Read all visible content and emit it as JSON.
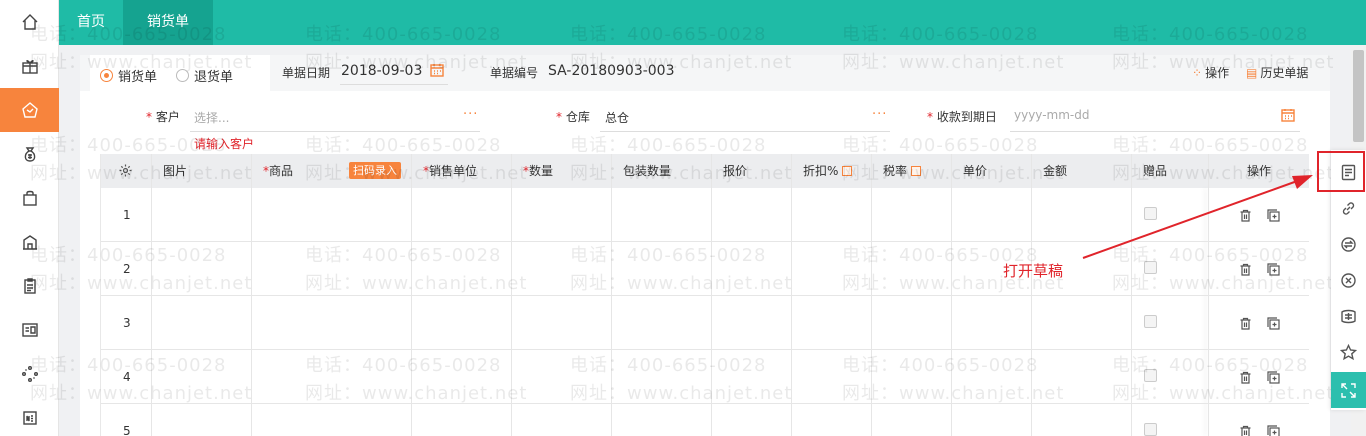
{
  "topbar": {
    "tab_home": "首页",
    "tab_active": "销货单"
  },
  "doc_type": {
    "sales": "销货单",
    "return": "退货单",
    "selected": "销货单"
  },
  "header": {
    "date_label": "单据日期",
    "date_value": "2018-09-03",
    "docno_label": "单据编号",
    "docno_value": "SA-20180903-003",
    "action_label": "操作",
    "history_label": "历史单据"
  },
  "fields": {
    "customer_label": "客户",
    "customer_placeholder": "选择...",
    "customer_error": "请输入客户",
    "warehouse_label": "仓库",
    "warehouse_value": "总仓",
    "due_label": "收款到期日",
    "due_placeholder": "yyyy-mm-dd",
    "more_dots": "···",
    "required_mark": "*"
  },
  "grid": {
    "columns": {
      "image": "图片",
      "product": "商品",
      "scan": "扫码录入",
      "unit": "销售单位",
      "qty": "数量",
      "pack_qty": "包装数量",
      "quote": "报价",
      "discount": "折扣%",
      "tax": "税率",
      "price": "单价",
      "amount": "金额",
      "gift": "赠品",
      "ops": "操作"
    },
    "rows": [
      "1",
      "2",
      "3",
      "4",
      "5"
    ]
  },
  "watermark": {
    "phone": "电话：400-665-0028",
    "site": "网址：www.chanjet.net"
  },
  "annotation": "打开草稿",
  "colors": {
    "brand_teal": "#1fbba6",
    "accent_orange": "#f7843d",
    "alert_red": "#e0242b"
  },
  "icons": {
    "leftnav": [
      "home-icon",
      "gift-icon",
      "sales-icon",
      "money-bag-icon",
      "bag-icon",
      "building-icon",
      "clipboard-icon",
      "id-card-icon",
      "loading-icon",
      "new-icon"
    ],
    "righttool": [
      "draft-icon",
      "link-icon",
      "exchange-icon",
      "cancel-icon",
      "compare-icon",
      "star-icon",
      "expand-icon"
    ]
  }
}
